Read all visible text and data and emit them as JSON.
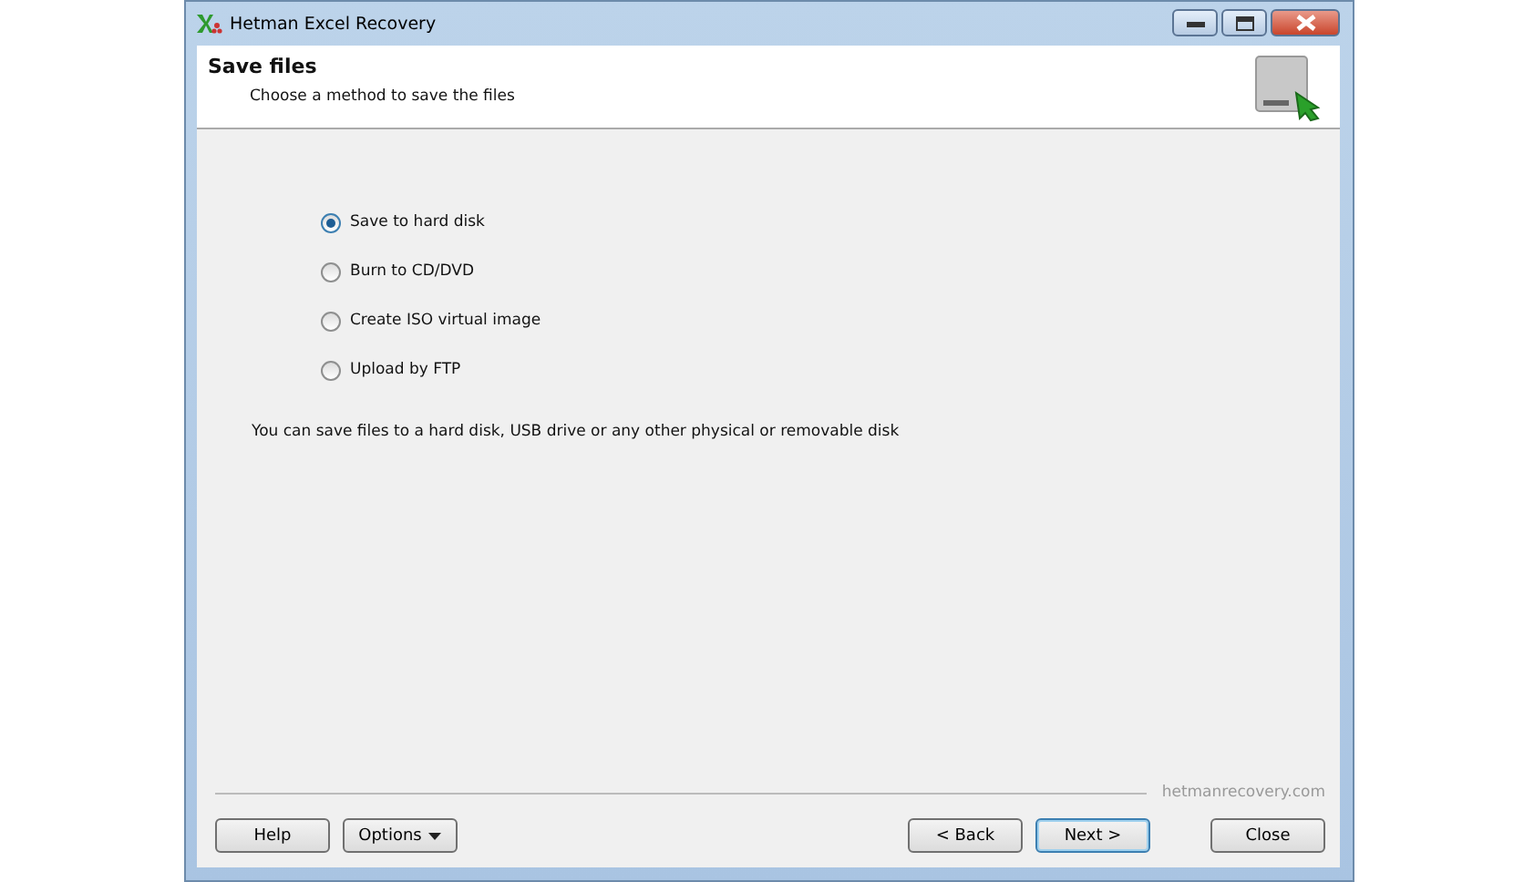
{
  "window": {
    "title": "Hetman Excel Recovery"
  },
  "header": {
    "title": "Save files",
    "subtitle": "Choose a method to save the files"
  },
  "options": [
    {
      "label": "Save to hard disk",
      "selected": true
    },
    {
      "label": "Burn to CD/DVD",
      "selected": false
    },
    {
      "label": "Create ISO virtual image",
      "selected": false
    },
    {
      "label": "Upload by FTP",
      "selected": false
    }
  ],
  "description": "You can save files to a hard disk, USB drive or any other physical or removable disk",
  "website": "hetmanrecovery.com",
  "buttons": {
    "left": [
      {
        "label": "Help",
        "kind": "plain"
      },
      {
        "label": "Options",
        "kind": "menu"
      }
    ],
    "right": [
      {
        "label": "< Back",
        "default": false
      },
      {
        "label": "Next >",
        "default": true
      }
    ],
    "close": "Close"
  }
}
